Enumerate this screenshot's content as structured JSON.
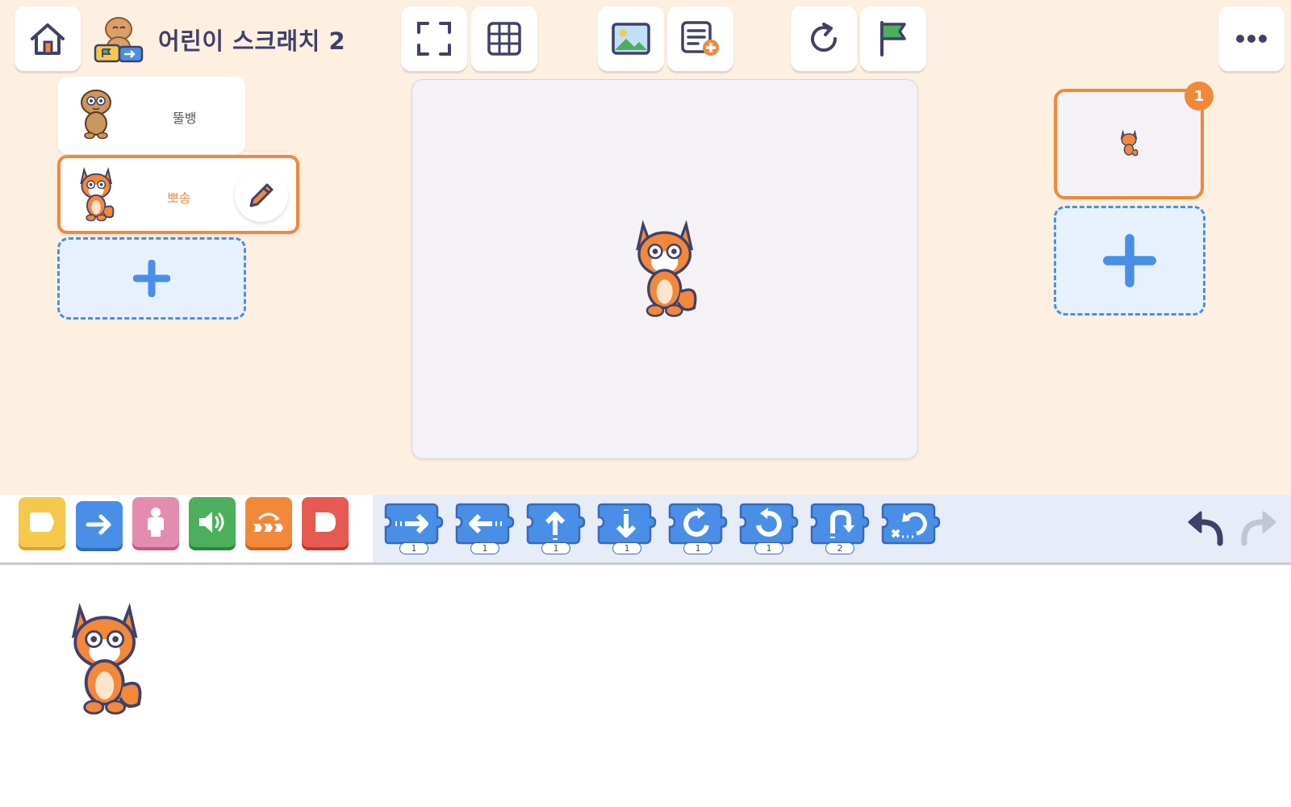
{
  "app": {
    "title": "어린이 스크래치 2"
  },
  "toolbar": {
    "home": "home-icon",
    "fullscreen": "fullscreen-icon",
    "grid": "grid-icon",
    "background": "image-icon",
    "add_text": "add-text-icon",
    "reset": "reset-icon",
    "green_flag": "green-flag-icon",
    "more": "more-icon"
  },
  "characters": [
    {
      "name": "뚤뱅",
      "selected": false
    },
    {
      "name": "뽀송",
      "selected": true
    }
  ],
  "pages": {
    "count_badge": "1"
  },
  "palette": {
    "categories": [
      {
        "name": "triggering",
        "color": "#f5c84c"
      },
      {
        "name": "motion",
        "color": "#4a8fe7"
      },
      {
        "name": "looks",
        "color": "#e48bb0"
      },
      {
        "name": "sound",
        "color": "#4caf5c"
      },
      {
        "name": "control",
        "color": "#f2883a"
      },
      {
        "name": "end",
        "color": "#e55b52"
      }
    ],
    "blocks": [
      {
        "name": "move-right",
        "value": "1"
      },
      {
        "name": "move-left",
        "value": "1"
      },
      {
        "name": "move-up",
        "value": "1"
      },
      {
        "name": "move-down",
        "value": "1"
      },
      {
        "name": "turn-right",
        "value": "1"
      },
      {
        "name": "turn-left",
        "value": "1"
      },
      {
        "name": "hop",
        "value": "2"
      },
      {
        "name": "go-home",
        "value": ""
      }
    ]
  },
  "colors": {
    "accent": "#f2883a",
    "blue": "#4a8fe7",
    "background": "#fdf0e0"
  }
}
